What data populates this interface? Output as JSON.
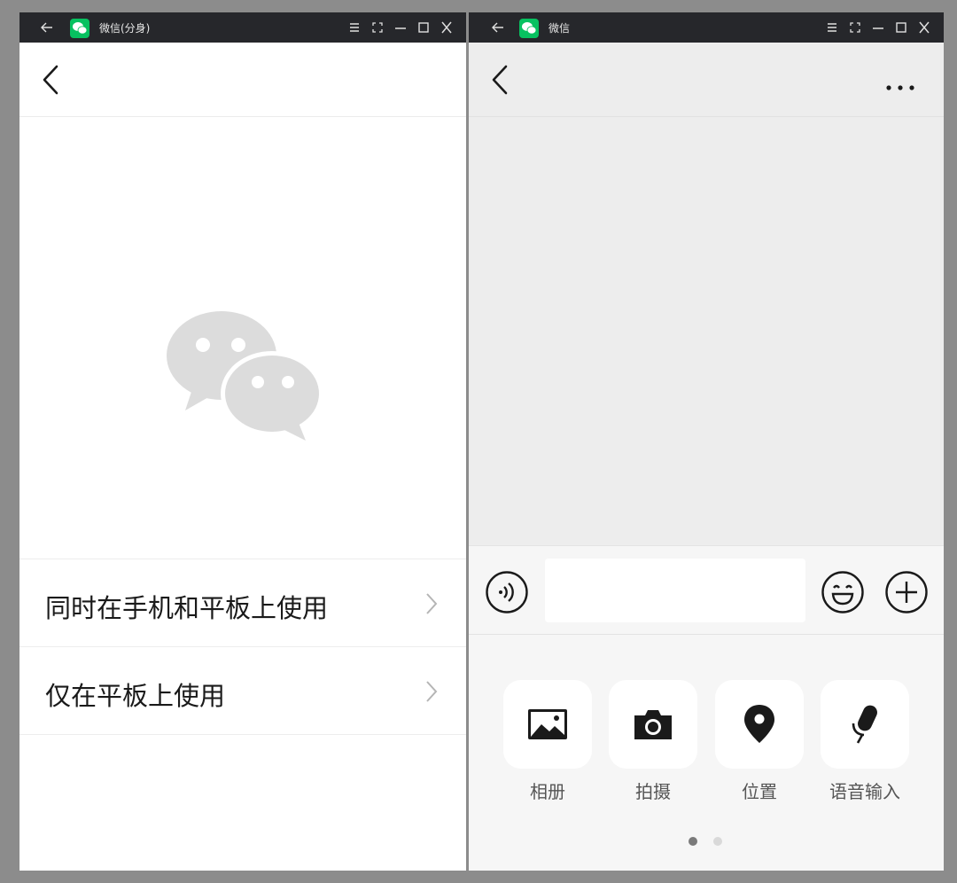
{
  "left_window": {
    "titlebar": {
      "title": "微信(分身)"
    },
    "options": [
      {
        "label": "同时在手机和平板上使用"
      },
      {
        "label": "仅在平板上使用"
      }
    ]
  },
  "right_window": {
    "titlebar": {
      "title": "微信"
    },
    "input": {
      "value": "",
      "placeholder": ""
    },
    "tools": [
      {
        "label": "相册",
        "icon": "photo-icon"
      },
      {
        "label": "拍摄",
        "icon": "camera-icon"
      },
      {
        "label": "位置",
        "icon": "location-icon"
      },
      {
        "label": "语音输入",
        "icon": "microphone-icon"
      }
    ],
    "page_indicator": {
      "count": 2,
      "active": 0
    }
  },
  "colors": {
    "titlebar_bg": "#26272b",
    "brand_green": "#07c160",
    "desktop_bg": "#8c8c8c",
    "dot_active": "#7a7a7a",
    "dot_inactive": "#d9d9d9"
  }
}
